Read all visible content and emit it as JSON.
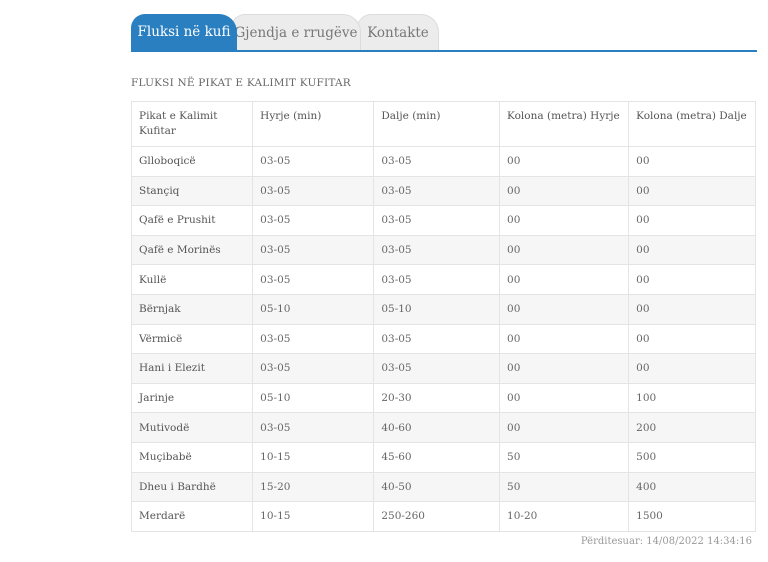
{
  "tabs": [
    {
      "label": "Fluksi në kufi",
      "active": true
    },
    {
      "label": "Gjendja e rrugëve",
      "active": false
    },
    {
      "label": "Kontakte",
      "active": false
    }
  ],
  "section_title": "FLUKSI NË PIKAT E KALIMIT KUFITAR",
  "table": {
    "headers": [
      "Pikat e Kalimit Kufitar",
      "Hyrje (min)",
      "Dalje (min)",
      "Kolona (metra) Hyrje",
      "Kolona (metra) Dalje"
    ],
    "rows": [
      [
        "Glloboqicë",
        "03-05",
        "03-05",
        "00",
        "00"
      ],
      [
        "Stançiq",
        "03-05",
        "03-05",
        "00",
        "00"
      ],
      [
        "Qafë e Prushit",
        "03-05",
        "03-05",
        "00",
        "00"
      ],
      [
        "Qafë e Morinës",
        "03-05",
        "03-05",
        "00",
        "00"
      ],
      [
        "Kullë",
        "03-05",
        "03-05",
        "00",
        "00"
      ],
      [
        "Bërnjak",
        "05-10",
        "05-10",
        "00",
        "00"
      ],
      [
        "Vërmicë",
        "03-05",
        "03-05",
        "00",
        "00"
      ],
      [
        "Hani i Elezit",
        "03-05",
        "03-05",
        "00",
        "00"
      ],
      [
        "Jarinje",
        "05-10",
        "20-30",
        "00",
        "100"
      ],
      [
        "Mutivodë",
        "03-05",
        "40-60",
        "00",
        "200"
      ],
      [
        "Muçibabë",
        "10-15",
        "45-60",
        "50",
        "500"
      ],
      [
        "Dheu i Bardhë",
        "15-20",
        "40-50",
        "50",
        "400"
      ],
      [
        "Merdarë",
        "10-15",
        "250-260",
        "10-20",
        "1500"
      ]
    ]
  },
  "updated": "Përditesuar: 14/08/2022 14:34:16",
  "colors": {
    "accent": "#2a7fc1",
    "tab_inactive": "#ececec",
    "row_alt": "#f6f6f6"
  }
}
